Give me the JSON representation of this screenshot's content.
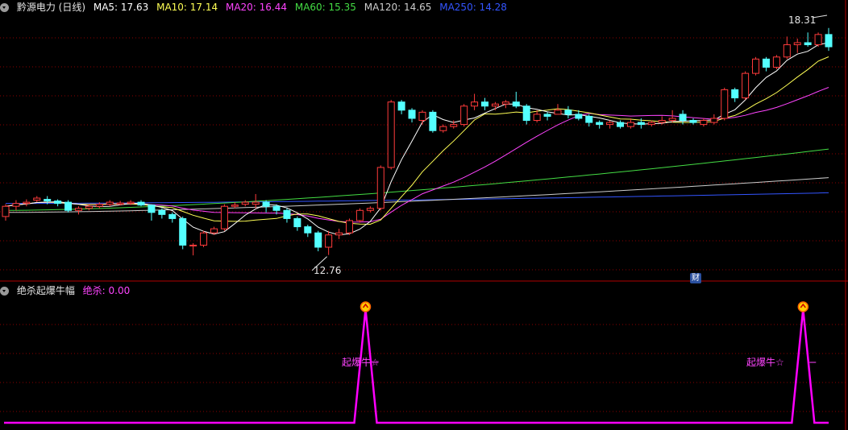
{
  "header": {
    "title": "黔源电力 (日线)",
    "ma": [
      {
        "label": "MA5: 17.63",
        "color": "#ffffff"
      },
      {
        "label": "MA10: 17.14",
        "color": "#ffff55"
      },
      {
        "label": "MA20: 16.44",
        "color": "#ff44ff"
      },
      {
        "label": "MA60: 15.35",
        "color": "#44dd44"
      },
      {
        "label": "MA120: 14.65",
        "color": "#cccccc"
      },
      {
        "label": "MA250: 14.28",
        "color": "#3355ff"
      }
    ]
  },
  "sub_header": {
    "title": "绝杀起爆牛幅",
    "value": "绝杀: 0.00"
  },
  "annotations": {
    "high": "18.31",
    "low": "12.76",
    "signal_1": "起爆牛☆",
    "signal_2": "起爆牛☆",
    "badge": "财"
  },
  "colors": {
    "up": "#ff3b3b",
    "down": "#54ffff",
    "grid": "#8b0000",
    "signal": "#ff00ff"
  },
  "chart_data": {
    "type": "candlestick",
    "price_range": [
      12.3,
      18.6
    ],
    "candles": [
      [
        13.7,
        13.95,
        14.0,
        13.6
      ],
      [
        13.95,
        14.02,
        14.1,
        13.85
      ],
      [
        14.02,
        14.05,
        14.12,
        13.95
      ],
      [
        14.1,
        14.15,
        14.2,
        14.05
      ],
      [
        14.12,
        14.08,
        14.2,
        14.0
      ],
      [
        14.08,
        14.02,
        14.12,
        13.95
      ],
      [
        14.05,
        13.85,
        14.1,
        13.8
      ],
      [
        13.85,
        13.9,
        13.95,
        13.75
      ],
      [
        13.9,
        13.95,
        14.0,
        13.85
      ],
      [
        13.95,
        14.0,
        14.05,
        13.9
      ],
      [
        14.0,
        14.05,
        14.1,
        13.95
      ],
      [
        14.0,
        14.03,
        14.08,
        13.97
      ],
      [
        14.02,
        14.05,
        14.1,
        13.98
      ],
      [
        14.05,
        13.98,
        14.1,
        13.95
      ],
      [
        13.98,
        13.8,
        14.0,
        13.6
      ],
      [
        13.85,
        13.75,
        13.9,
        13.65
      ],
      [
        13.75,
        13.65,
        13.8,
        13.55
      ],
      [
        13.65,
        13.0,
        13.7,
        12.9
      ],
      [
        13.0,
        13.0,
        13.05,
        12.75
      ],
      [
        13.0,
        13.3,
        13.35,
        12.95
      ],
      [
        13.3,
        13.4,
        13.45,
        13.25
      ],
      [
        13.4,
        13.95,
        14.0,
        13.35
      ],
      [
        13.95,
        13.98,
        14.05,
        13.9
      ],
      [
        14.0,
        14.05,
        14.1,
        13.95
      ],
      [
        14.0,
        14.05,
        14.25,
        13.9
      ],
      [
        14.05,
        13.95,
        14.1,
        13.8
      ],
      [
        13.95,
        13.85,
        14.0,
        13.75
      ],
      [
        13.85,
        13.65,
        13.9,
        13.55
      ],
      [
        13.65,
        13.45,
        13.7,
        13.35
      ],
      [
        13.45,
        13.3,
        13.5,
        13.2
      ],
      [
        13.3,
        12.95,
        13.35,
        12.85
      ],
      [
        12.95,
        13.25,
        13.35,
        12.76
      ],
      [
        13.25,
        13.3,
        13.4,
        13.15
      ],
      [
        13.3,
        13.6,
        13.65,
        13.25
      ],
      [
        13.6,
        13.85,
        13.9,
        13.55
      ],
      [
        13.85,
        13.9,
        13.95,
        13.8
      ],
      [
        13.9,
        14.9,
        14.95,
        13.85
      ],
      [
        14.9,
        16.5,
        16.55,
        14.85
      ],
      [
        16.5,
        16.3,
        16.55,
        16.2
      ],
      [
        16.3,
        16.1,
        16.35,
        16.0
      ],
      [
        16.05,
        16.25,
        16.3,
        15.95
      ],
      [
        16.25,
        15.8,
        16.3,
        15.75
      ],
      [
        15.8,
        15.9,
        15.95,
        15.75
      ],
      [
        15.9,
        15.95,
        16.05,
        15.85
      ],
      [
        15.95,
        16.4,
        16.45,
        15.9
      ],
      [
        16.4,
        16.5,
        16.7,
        16.3
      ],
      [
        16.5,
        16.4,
        16.6,
        16.3
      ],
      [
        16.4,
        16.45,
        16.5,
        16.3
      ],
      [
        16.45,
        16.5,
        16.55,
        16.35
      ],
      [
        16.5,
        16.4,
        16.75,
        16.35
      ],
      [
        16.4,
        16.05,
        16.45,
        15.95
      ],
      [
        16.05,
        16.2,
        16.3,
        16.0
      ],
      [
        16.2,
        16.15,
        16.25,
        16.05
      ],
      [
        16.2,
        16.3,
        16.45,
        16.2
      ],
      [
        16.3,
        16.2,
        16.4,
        16.1
      ],
      [
        16.2,
        16.1,
        16.3,
        16.05
      ],
      [
        16.15,
        16.0,
        16.2,
        15.9
      ],
      [
        16.0,
        15.95,
        16.05,
        15.85
      ],
      [
        15.95,
        16.0,
        16.05,
        15.85
      ],
      [
        16.0,
        15.9,
        16.05,
        15.85
      ],
      [
        15.9,
        16.0,
        16.1,
        15.85
      ],
      [
        16.0,
        15.95,
        16.1,
        15.85
      ],
      [
        15.95,
        16.0,
        16.05,
        15.9
      ],
      [
        16.0,
        16.05,
        16.15,
        15.95
      ],
      [
        16.05,
        16.1,
        16.3,
        16.0
      ],
      [
        16.2,
        16.05,
        16.3,
        15.95
      ],
      [
        16.05,
        16.0,
        16.1,
        15.95
      ],
      [
        15.95,
        16.05,
        16.1,
        15.9
      ],
      [
        16.0,
        16.1,
        16.2,
        15.95
      ],
      [
        16.1,
        16.8,
        16.85,
        16.05
      ],
      [
        16.8,
        16.6,
        16.85,
        16.5
      ],
      [
        16.6,
        17.2,
        17.25,
        16.55
      ],
      [
        17.2,
        17.55,
        17.6,
        17.15
      ],
      [
        17.55,
        17.35,
        17.6,
        17.25
      ],
      [
        17.35,
        17.6,
        17.65,
        17.3
      ],
      [
        17.6,
        17.9,
        18.1,
        17.55
      ],
      [
        17.9,
        17.95,
        18.05,
        17.7
      ],
      [
        17.95,
        17.9,
        18.2,
        17.85
      ],
      [
        17.9,
        18.15,
        18.2,
        17.85
      ],
      [
        18.15,
        17.85,
        18.31,
        17.75
      ]
    ],
    "ma_end_values": {
      "MA5": 17.63,
      "MA10": 17.14,
      "MA20": 16.44,
      "MA60": 15.35,
      "MA120": 14.65,
      "MA250": 14.28
    },
    "indicator": {
      "name": "绝杀",
      "value": 0.0,
      "peaks": [
        33,
        75
      ]
    }
  }
}
